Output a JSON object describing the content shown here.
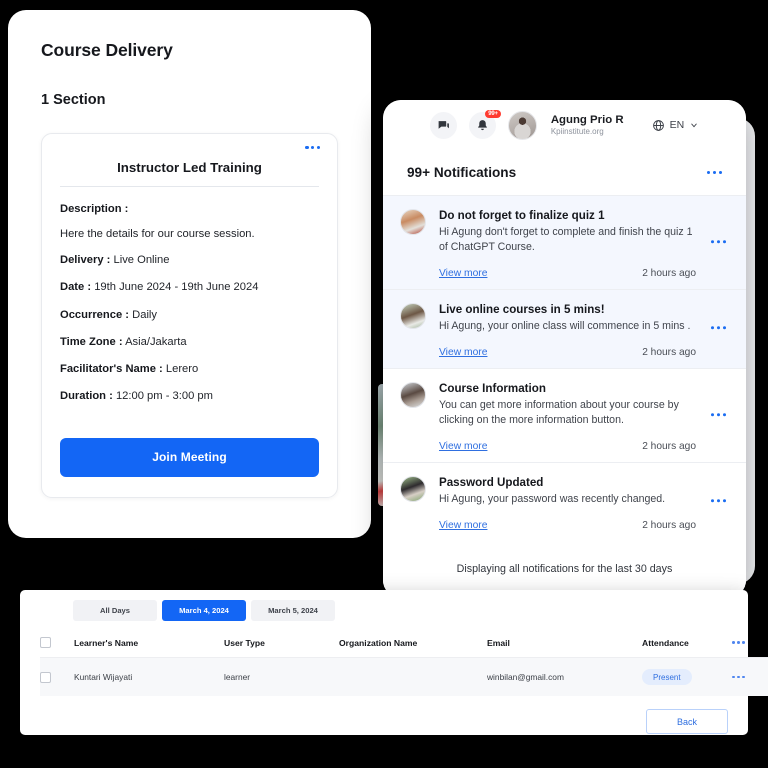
{
  "course_panel": {
    "page_title": "Course Delivery",
    "section_count": "1 Section",
    "session": {
      "title": "Instructor Led Training",
      "description_label": "Description :",
      "description_value": "Here the details for our course session.",
      "fields": [
        {
          "label": "Delivery :",
          "value": "Live Online"
        },
        {
          "label": "Date :",
          "value": "19th June 2024 - 19th June 2024"
        },
        {
          "label": "Occurrence :",
          "value": "Daily"
        },
        {
          "label": "Time Zone :",
          "value": "Asia/Jakarta"
        },
        {
          "label": "Facilitator's Name :",
          "value": "Lerero"
        },
        {
          "label": "Duration :",
          "value": "12:00 pm - 3:00 pm"
        }
      ],
      "join_label": "Join Meeting"
    }
  },
  "notification_window": {
    "topbar": {
      "chat_icon": "chat-bubbles-icon",
      "bell_icon": "bell-icon",
      "bell_badge": "99+",
      "avatar": "user-avatar",
      "user_name": "Agung Prio R",
      "user_org": "Kpiinstitute.org",
      "globe_icon": "globe-icon",
      "language": "EN",
      "chevron_icon": "chevron-down-icon"
    },
    "header_title": "99+ Notifications",
    "items": [
      {
        "title": "Do not forget  to finalize quiz 1",
        "text": "Hi Agung don't forget to complete and finish the quiz 1 of ChatGPT Course.",
        "link": "View more",
        "time": "2 hours ago",
        "state": "unread"
      },
      {
        "title": "Live online courses in 5 mins!",
        "text": "Hi Agung, your online class will commence in 5 mins .",
        "link": "View more",
        "time": "2 hours ago",
        "state": "unread"
      },
      {
        "title": "Course Information",
        "text": "You can get more information about your course by clicking on the more information button.",
        "link": "View more",
        "time": "2 hours ago",
        "state": "read"
      },
      {
        "title": "Password Updated",
        "text": "Hi Agung, your password was recently changed.",
        "link": "View more",
        "time": "2 hours ago",
        "state": "read"
      }
    ],
    "footer_note": "Displaying all notifications for the last 30 days"
  },
  "table_panel": {
    "day_tabs": [
      {
        "label": "All Days",
        "active": false
      },
      {
        "label": "March 4, 2024",
        "active": true
      },
      {
        "label": "March 5, 2024",
        "active": false
      }
    ],
    "columns": [
      "Learner's Name",
      "User Type",
      "Organization Name",
      "Email",
      "Attendance"
    ],
    "rows": [
      {
        "name": "Kuntari Wijayati",
        "user_type": "learner",
        "organization": "",
        "email": "winbilan@gmail.com",
        "attendance": "Present"
      }
    ],
    "back_label": "Back"
  },
  "colors": {
    "accent_blue": "#1366f5",
    "link_blue": "#2f6fe0",
    "badge_red": "#ff3b30",
    "unread_bg": "#f4f7fe",
    "present_bg": "#e4edfd",
    "page_bg": "#000000"
  }
}
